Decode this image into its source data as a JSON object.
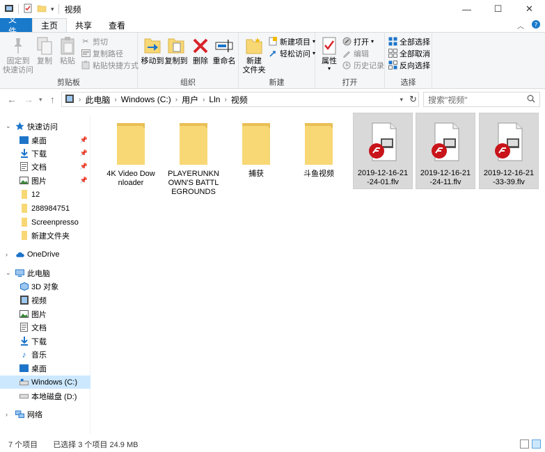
{
  "window": {
    "title": "视频",
    "min": "—",
    "max": "☐",
    "close": "✕"
  },
  "tabs": [
    {
      "label": "文件"
    },
    {
      "label": "主页"
    },
    {
      "label": "共享"
    },
    {
      "label": "查看"
    }
  ],
  "ribbon": {
    "clipboard": {
      "label": "剪贴板",
      "pin": "固定到\n快速访问",
      "pin1": "固定到",
      "pin2": "快速访问",
      "copy": "复制",
      "paste": "粘贴",
      "cut": "剪切",
      "copy_path": "复制路径",
      "paste_shortcut": "粘贴快捷方式"
    },
    "organize": {
      "label": "组织",
      "move_to": "移动到",
      "copy_to": "复制到",
      "delete": "删除",
      "rename": "重命名"
    },
    "new": {
      "label": "新建",
      "new_folder1": "新建",
      "new_folder2": "文件夹",
      "new_item": "新建项目",
      "easy_access": "轻松访问"
    },
    "open": {
      "label": "打开",
      "properties": "属性",
      "open": "打开",
      "edit": "编辑",
      "history": "历史记录"
    },
    "select": {
      "label": "选择",
      "select_all": "全部选择",
      "select_none": "全部取消",
      "invert": "反向选择"
    }
  },
  "address": {
    "crumbs": [
      "此电脑",
      "Windows (C:)",
      "用户",
      "Lln",
      "视频"
    ],
    "search_placeholder": "搜索\"视频\""
  },
  "nav": {
    "quick_access": "快速访问",
    "qa_items": [
      "桌面",
      "下载",
      "文档",
      "图片",
      "12",
      "288984751",
      "Screenpresso",
      "新建文件夹"
    ],
    "onedrive": "OneDrive",
    "this_pc": "此电脑",
    "pc_items": [
      "3D 对象",
      "视频",
      "图片",
      "文档",
      "下载",
      "音乐",
      "桌面",
      "Windows (C:)",
      "本地磁盘 (D:)"
    ],
    "network": "网络"
  },
  "files": [
    {
      "name": "4K Video Downloader",
      "type": "folder",
      "selected": false
    },
    {
      "name": "PLAYERUNKNOWN'S BATTLEGROUNDS",
      "type": "folder",
      "selected": false
    },
    {
      "name": "捕获",
      "type": "folder",
      "selected": false
    },
    {
      "name": "斗鱼视频",
      "type": "folder",
      "selected": false
    },
    {
      "name": "2019-12-16-21-24-01.flv",
      "type": "flv",
      "selected": true
    },
    {
      "name": "2019-12-16-21-24-11.flv",
      "type": "flv",
      "selected": true
    },
    {
      "name": "2019-12-16-21-33-39.flv",
      "type": "flv",
      "selected": true
    }
  ],
  "status": {
    "count": "7 个项目",
    "selected": "已选择 3 个项目 24.9 MB"
  },
  "colors": {
    "accent": "#1979ca",
    "folder": "#f8d775",
    "selection": "#cce8ff"
  }
}
